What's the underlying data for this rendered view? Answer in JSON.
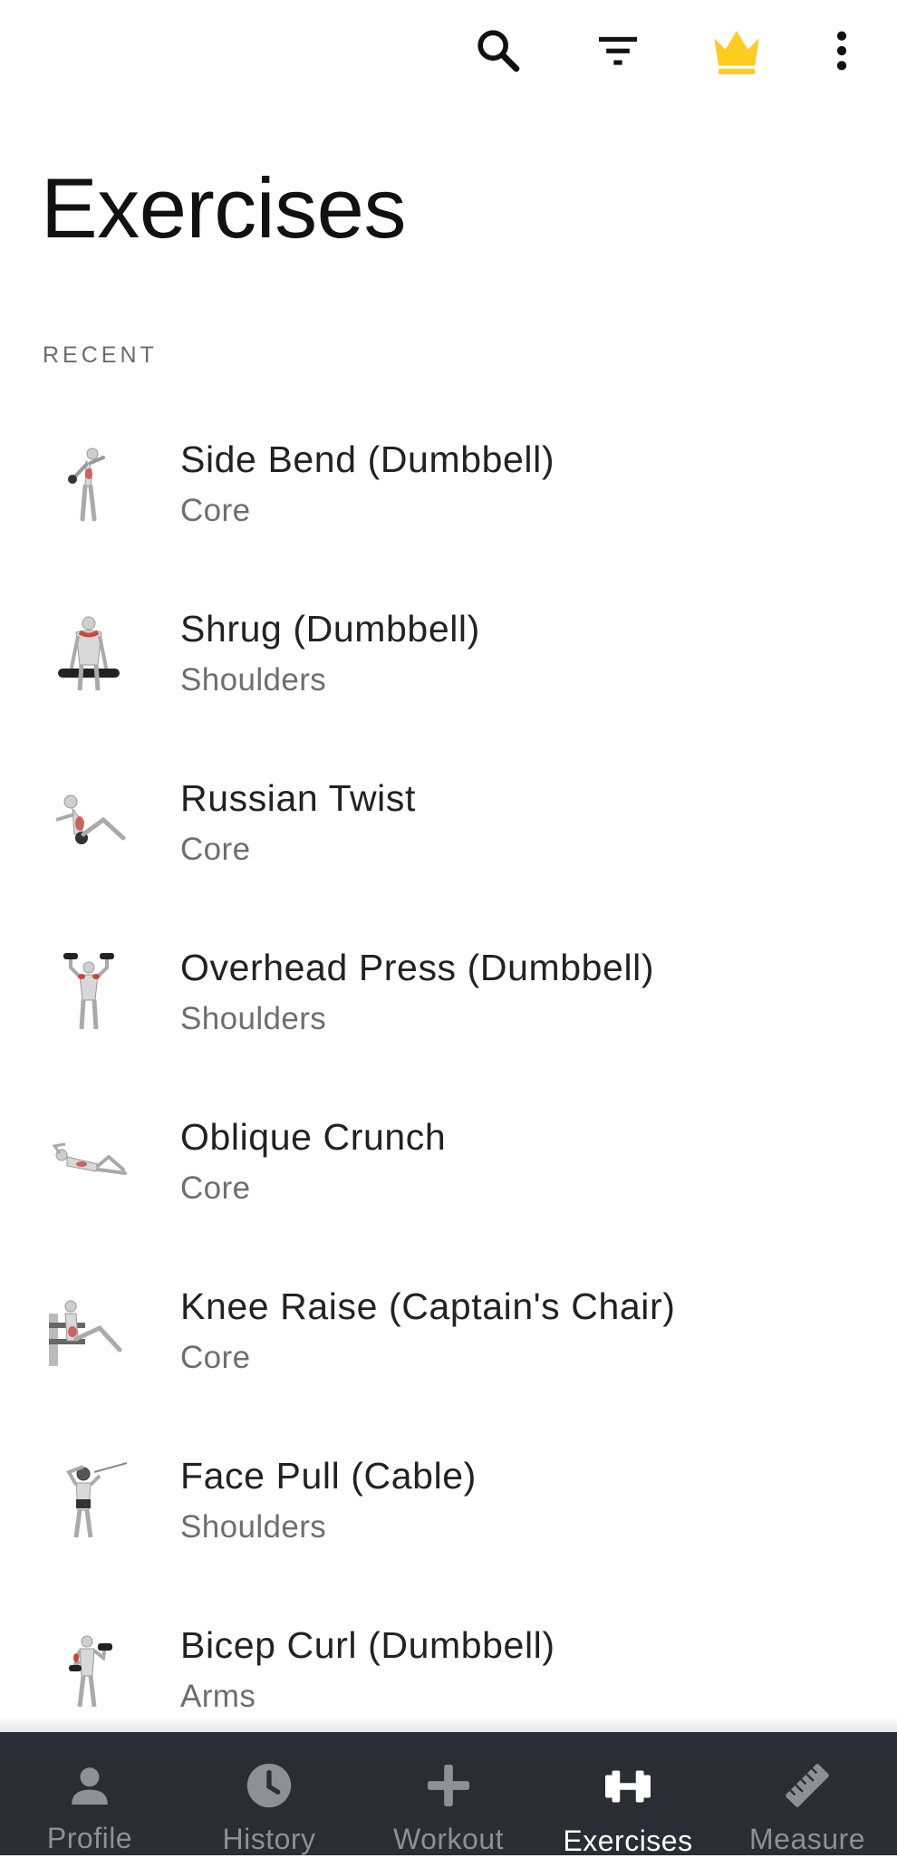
{
  "toolbar": {
    "icons": [
      "search-icon",
      "filter-icon",
      "crown-icon",
      "more-vert-icon"
    ],
    "crown_color": "#FFCC1F"
  },
  "page": {
    "title": "Exercises",
    "section_label": "RECENT"
  },
  "exercises": [
    {
      "name": "Side Bend (Dumbbell)",
      "category": "Core"
    },
    {
      "name": "Shrug (Dumbbell)",
      "category": "Shoulders"
    },
    {
      "name": "Russian Twist",
      "category": "Core"
    },
    {
      "name": "Overhead Press (Dumbbell)",
      "category": "Shoulders"
    },
    {
      "name": "Oblique Crunch",
      "category": "Core"
    },
    {
      "name": "Knee Raise (Captain's Chair)",
      "category": "Core"
    },
    {
      "name": "Face Pull (Cable)",
      "category": "Shoulders"
    },
    {
      "name": "Bicep Curl (Dumbbell)",
      "category": "Arms"
    }
  ],
  "bottom_nav": {
    "active": "Exercises",
    "items": [
      {
        "label": "Profile",
        "icon": "person-icon"
      },
      {
        "label": "History",
        "icon": "clock-icon"
      },
      {
        "label": "Workout",
        "icon": "plus-icon"
      },
      {
        "label": "Exercises",
        "icon": "dumbbell-icon"
      },
      {
        "label": "Measure",
        "icon": "ruler-icon"
      }
    ],
    "background": "#2A2E34",
    "active_color": "#FFFFFF",
    "inactive_color": "#8D9096"
  }
}
